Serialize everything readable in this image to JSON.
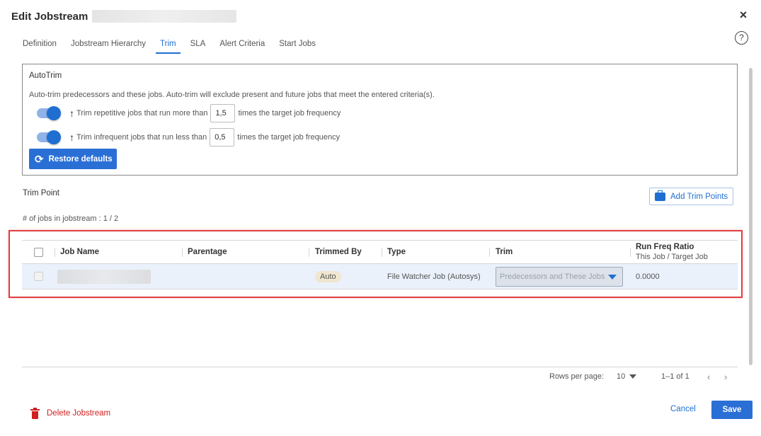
{
  "dialog": {
    "title": "Edit Jobstream",
    "close_icon": "×",
    "help_icon": "?"
  },
  "tabs": [
    {
      "label": "Definition"
    },
    {
      "label": "Jobstream Hierarchy"
    },
    {
      "label": "Trim",
      "active": true
    },
    {
      "label": "SLA"
    },
    {
      "label": "Alert Criteria"
    },
    {
      "label": "Start Jobs"
    }
  ],
  "autotrim": {
    "title": "AutoTrim",
    "description": "Auto-trim predecessors and these jobs. Auto-trim will exclude present and future jobs that meet the entered criteria(s).",
    "rule1": {
      "enabled": true,
      "label": "Trim repetitive jobs that run more than",
      "value": "1,5",
      "suffix": "times the target job frequency"
    },
    "rule2": {
      "enabled": true,
      "label": "Trim infrequent jobs that run less than",
      "value": "0,5",
      "suffix": "times the target job frequency"
    },
    "restore_label": "Restore defaults"
  },
  "trim_point": {
    "title": "Trim Point",
    "add_label": "Add Trim Points",
    "jobs_count": "# of jobs in jobstream : 1 / 2"
  },
  "table": {
    "columns": {
      "job_name": "Job Name",
      "parentage": "Parentage",
      "trimmed_by": "Trimmed By",
      "type": "Type",
      "trim": "Trim",
      "run_freq": "Run Freq Ratio",
      "run_freq_sub": "This Job / Target Job"
    },
    "rows": [
      {
        "job_name": "",
        "parentage": "",
        "trimmed_by": "Auto",
        "type": "File Watcher Job (Autosys)",
        "trim": "Predecessors and These Jobs",
        "run_freq": "0.0000"
      }
    ]
  },
  "pagination": {
    "rows_per_page_label": "Rows per page:",
    "rows_per_page": "10",
    "range": "1–1 of 1",
    "prev": "‹",
    "next": "›"
  },
  "footer": {
    "delete_label": "Delete Jobstream",
    "cancel_label": "Cancel",
    "save_label": "Save"
  },
  "colors": {
    "accent": "#1f6fd1",
    "primary_button": "#2a6fd6",
    "danger": "#d02020",
    "highlight_border": "#e04040",
    "row_selected": "#eaf1fb"
  }
}
